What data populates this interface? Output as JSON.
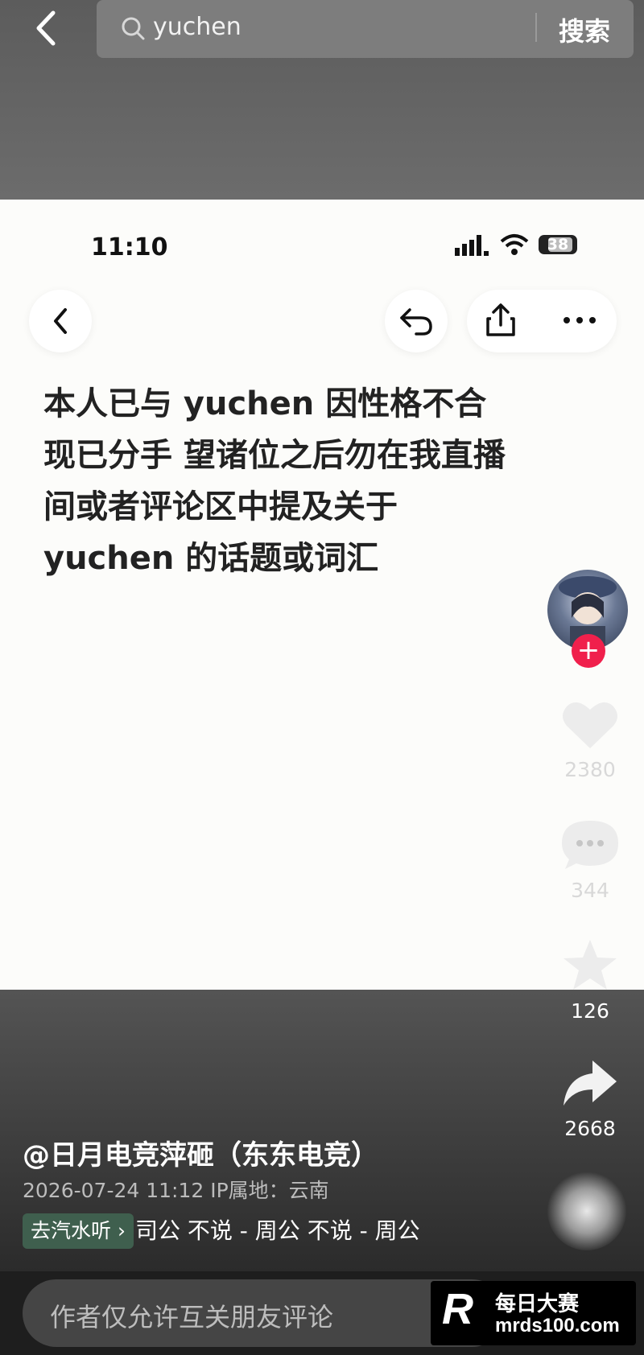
{
  "search": {
    "query": "yuchen",
    "submit_label": "搜索"
  },
  "post": {
    "status_time": "11:10",
    "battery": "38",
    "text_lines": [
      "本人已与 yuchen 因性格不合",
      "现已分手 望诸位之后勿在我直播",
      "间或者评论区中提及关于",
      "yuchen 的话题或词汇"
    ]
  },
  "actions": {
    "likes": "2380",
    "comments": "344",
    "favorites": "126",
    "shares": "2668"
  },
  "author": {
    "name": "@日月电竞萍砸（东东电竞）",
    "meta": "2026-07-24 11:12  IP属地：云南"
  },
  "music": {
    "tag_label": "去汽水听 ›",
    "scroll_text": "司公    不说 - 周公    不说 - 周公"
  },
  "comment_bar": {
    "placeholder": "作者仅允许互关朋友评论"
  },
  "watermark": {
    "logo": "R",
    "name": "每日大赛",
    "url": "mrds100.com"
  }
}
